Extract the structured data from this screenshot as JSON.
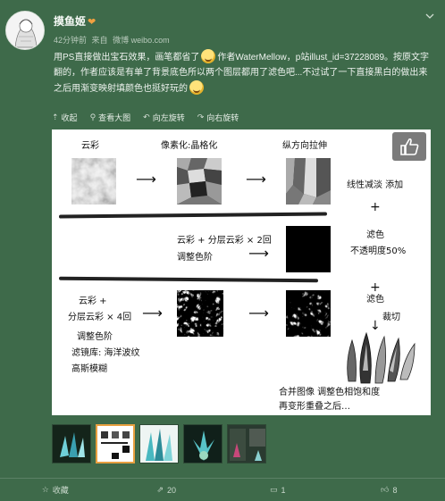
{
  "post": {
    "username": "摸鱼姬",
    "username_badge": "❤",
    "time": "42分钟前",
    "source_prefix": "来自",
    "source": "微博 weibo.com",
    "text_part1": "用PS直接做出宝石效果，画笔都省了",
    "text_part2": "作者WaterMellow，p站illust_id=37228089。按原文字翻的，作者应该是有单了背景底色所以两个图层都用了滤色吧...不过试了一下直接黑白的做出来之后用渐变映射填颜色也挺好玩的",
    "emoji_name": "happy-face-emoji"
  },
  "toolbar": {
    "collapse": "收起",
    "view_large": "查看大图",
    "rotate_left": "向左旋转",
    "rotate_right": "向右旋转"
  },
  "figure": {
    "yuncai": "云彩",
    "pixelate": "像素化:晶格化",
    "stretch": "纵方向拉伸",
    "linear_dodge": "线性减淡 添加",
    "plus1": "+",
    "layered_line1": "云彩 + 分层云彩 × 2回",
    "layered_line2": "调整色阶",
    "filter_color": "滤色",
    "opacity": "不透明度50%",
    "plus2": "+",
    "filter_color2": "滤色",
    "cut": "裁切",
    "bottom_line1": "云彩 +",
    "bottom_line2": "分层云彩 × 4回",
    "bottom_line3": "调整色阶",
    "bottom_line4": "滤镜库: 海洋波纹",
    "bottom_line5": "高斯模糊",
    "merge_line1": "合并图像 调整色相饱和度",
    "merge_line2": "再变形重叠之后…"
  },
  "thumbs": [
    {
      "name": "thumb-1"
    },
    {
      "name": "thumb-2",
      "active": true
    },
    {
      "name": "thumb-3"
    },
    {
      "name": "thumb-4"
    },
    {
      "name": "thumb-5"
    }
  ],
  "actions": {
    "favorite": "收藏",
    "repost": "20",
    "comment": "1",
    "like": "8"
  },
  "colors": {
    "background": "#3e6a4a",
    "accent": "#e8a040"
  }
}
